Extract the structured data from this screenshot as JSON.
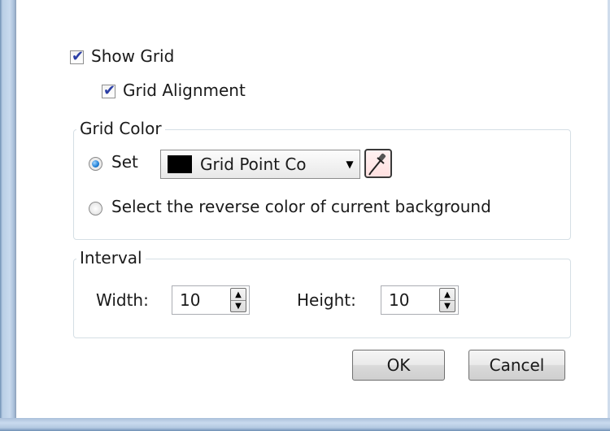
{
  "dialog": {
    "show_grid": {
      "label": "Show Grid",
      "checked": true
    },
    "grid_alignment": {
      "label": "Grid Alignment",
      "checked": true
    },
    "grid_color": {
      "legend": "Grid Color",
      "set_option": {
        "label": "Set",
        "selected": true
      },
      "color_combo": {
        "value": "Grid Point Co",
        "swatch_color": "#000000"
      },
      "color_picker_icon": "eyedropper-icon",
      "reverse_option": {
        "label": "Select the reverse color of current background",
        "selected": false
      }
    },
    "interval": {
      "legend": "Interval",
      "width_label": "Width:",
      "width_value": "10",
      "height_label": "Height:",
      "height_value": "10"
    },
    "buttons": {
      "ok_label": "OK",
      "cancel_label": "Cancel"
    }
  }
}
